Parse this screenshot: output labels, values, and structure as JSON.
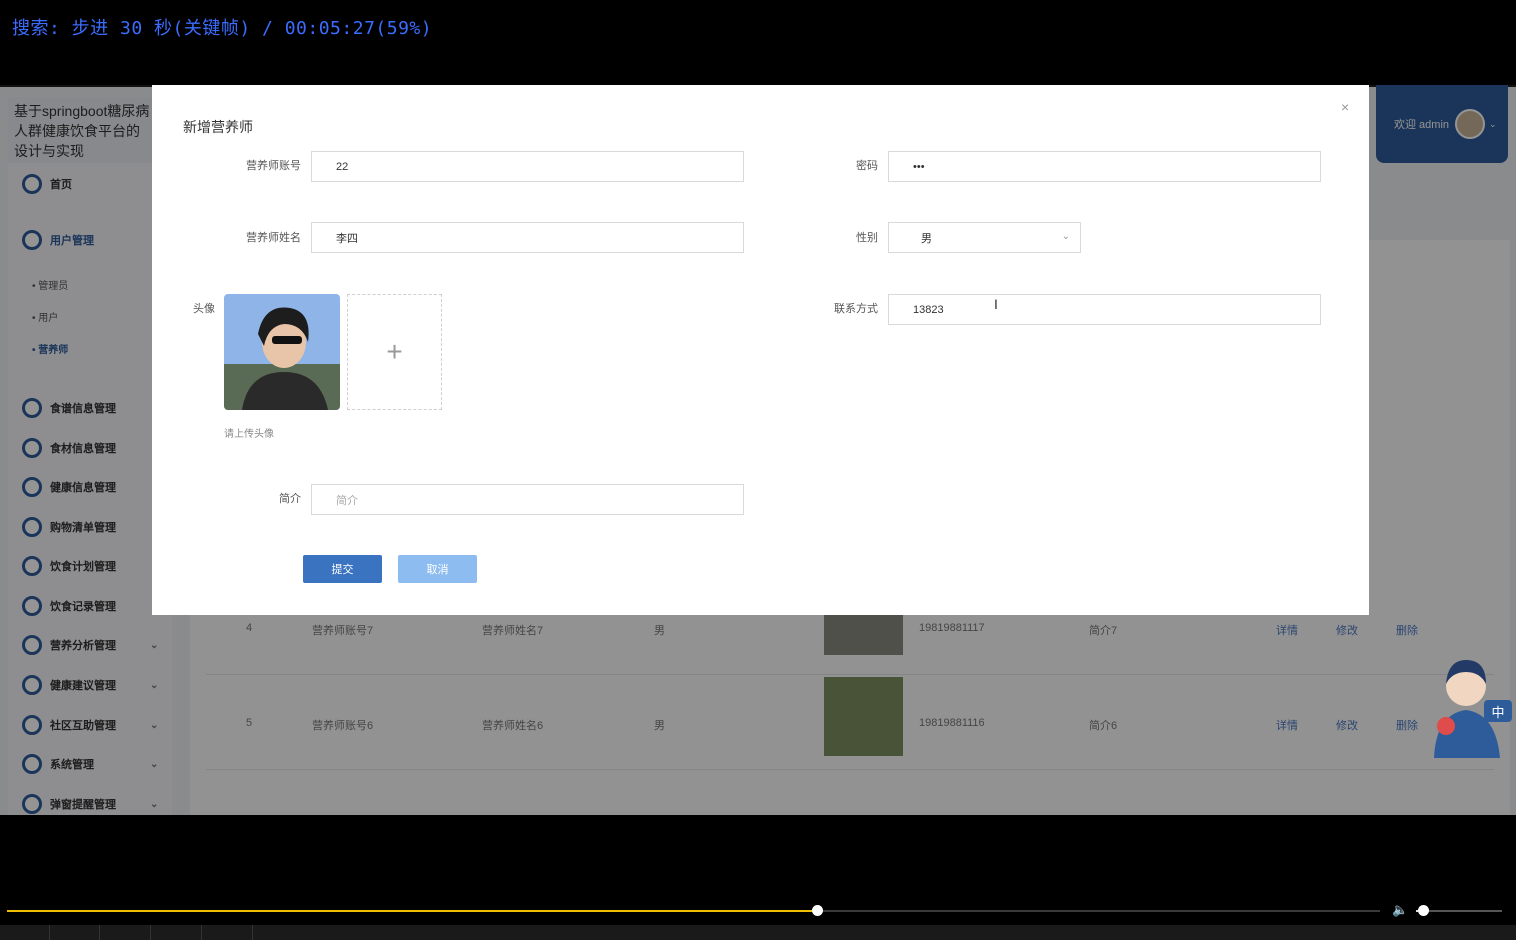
{
  "osd": {
    "text": "搜索: 步进 30 秒(关键帧) / 00:05:27(59%)"
  },
  "app": {
    "title": "基于springboot糖尿病人群健康饮食平台的设计与实现",
    "welcome": "欢迎 admin",
    "menu": {
      "home": "首页",
      "user_mgmt": "用户管理",
      "sub": [
        "管理员",
        "用户",
        "营养师"
      ],
      "items": [
        "食谱信息管理",
        "食材信息管理",
        "健康信息管理",
        "购物清单管理",
        "饮食计划管理",
        "饮食记录管理",
        "营养分析管理",
        "健康建议管理",
        "社区互助管理",
        "系统管理",
        "弹窗提醒管理"
      ]
    },
    "table": {
      "rows": [
        {
          "no": "4",
          "account": "营养师账号7",
          "name": "营养师姓名7",
          "gender": "男",
          "phone": "19819881117",
          "intro": "简介7"
        },
        {
          "no": "5",
          "account": "营养师账号6",
          "name": "营养师姓名6",
          "gender": "男",
          "phone": "19819881116",
          "intro": "简介6"
        }
      ],
      "actions": {
        "detail": "详情",
        "edit": "修改",
        "delete": "删除"
      }
    }
  },
  "modal": {
    "title": "新增营养师",
    "close": "×",
    "fields": {
      "account_label": "营养师账号",
      "account_value": "22",
      "password_label": "密码",
      "password_value": "•••",
      "name_label": "营养师姓名",
      "name_value": "李四",
      "gender_label": "性别",
      "gender_value": "男",
      "avatar_label": "头像",
      "avatar_hint": "请上传头像",
      "phone_label": "联系方式",
      "phone_value": "13823",
      "intro_label": "简介",
      "intro_placeholder": "简介"
    },
    "submit": "提交",
    "cancel": "取消"
  },
  "player": {
    "progress_fraction": 0.59,
    "volume_fraction": 0.08
  },
  "mascot": {
    "badge": "中"
  }
}
